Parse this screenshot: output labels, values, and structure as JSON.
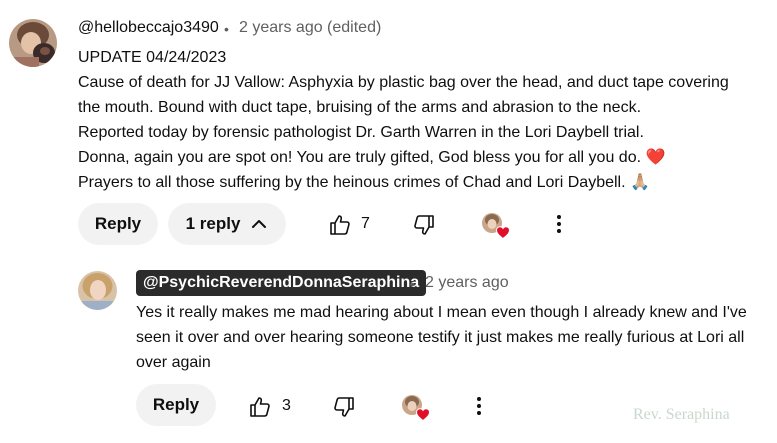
{
  "comment": {
    "author": "@hellobeccajo3490",
    "separator": "•",
    "timestamp": "2 years ago (edited)",
    "lines": [
      "UPDATE 04/24/2023",
      "Cause of death for JJ Vallow:  Asphyxia by plastic bag over the head, and duct tape covering",
      "the mouth. Bound with duct tape, bruising of the arms and abrasion to the neck.",
      "Reported today by forensic pathologist Dr. Garth Warren in the Lori Daybell trial.",
      "Donna, again you are spot on! You are truly gifted, God bless you for all you do.",
      "Prayers to all those suffering by the heinous crimes of Chad and Lori Daybell."
    ],
    "emoji_heart": "❤️",
    "emoji_pray": "🙏🏼",
    "reply_label": "Reply",
    "replies_label": "1 reply",
    "like_count": "7"
  },
  "reply": {
    "author": "@PsychicReverendDonnaSeraphina",
    "separator": "•",
    "timestamp": "2 years ago",
    "lines": [
      "Yes it really makes me mad hearing about I mean even though I already knew and I've",
      "seen it over and over hearing someone testify it just makes me really furious at Lori all",
      "over again"
    ],
    "reply_label": "Reply",
    "like_count": "3"
  },
  "watermark": "Rev. Seraphina",
  "icons": [
    "thumb-up-icon",
    "thumb-down-icon",
    "creator-heart-icon",
    "more-vert-icon",
    "chevron-up-icon"
  ],
  "colors": {
    "pill_bg": "#f2f2f2",
    "meta_text": "#606060",
    "badge_bg": "#2b2b2b",
    "heart": "#e0102a"
  }
}
